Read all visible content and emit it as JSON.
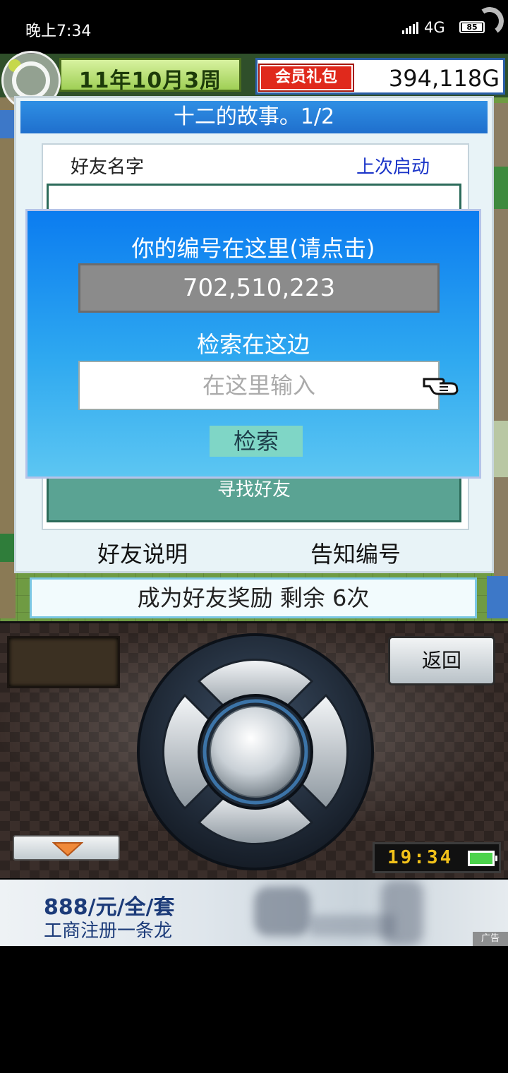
{
  "status_bar": {
    "time": "晚上7:34",
    "network": "4G",
    "battery": "85"
  },
  "hud": {
    "date": "11年10月3周",
    "vip_label": "会员礼包",
    "money": "394,118G"
  },
  "friend_panel": {
    "title": "十二的故事。1/2",
    "col_friend_name": "好友名字",
    "col_last_launch": "上次启动",
    "find_friend": "寻找好友",
    "tab_explain": "好友说明",
    "tab_notify": "告知编号",
    "reward_text": "成为好友奖励 剩余 6次"
  },
  "id_popup": {
    "caption": "你的编号在这里(请点击)",
    "id_number": "702,510,223",
    "search_caption": "检索在这边",
    "search_placeholder": "在这里输入",
    "search_button": "检索"
  },
  "controller": {
    "back_button": "返回",
    "clock": "19:34"
  },
  "ad": {
    "headline": "888/元/全/套",
    "subline": "工商注册一条龙",
    "tag": "广告"
  },
  "colors": {
    "panel_title": "#1f6fcd",
    "popup_blue": "#0b7cf0",
    "find_friend_green": "#5aa393",
    "vip_red": "#e0291c",
    "clock_yellow": "#f2c21a"
  }
}
